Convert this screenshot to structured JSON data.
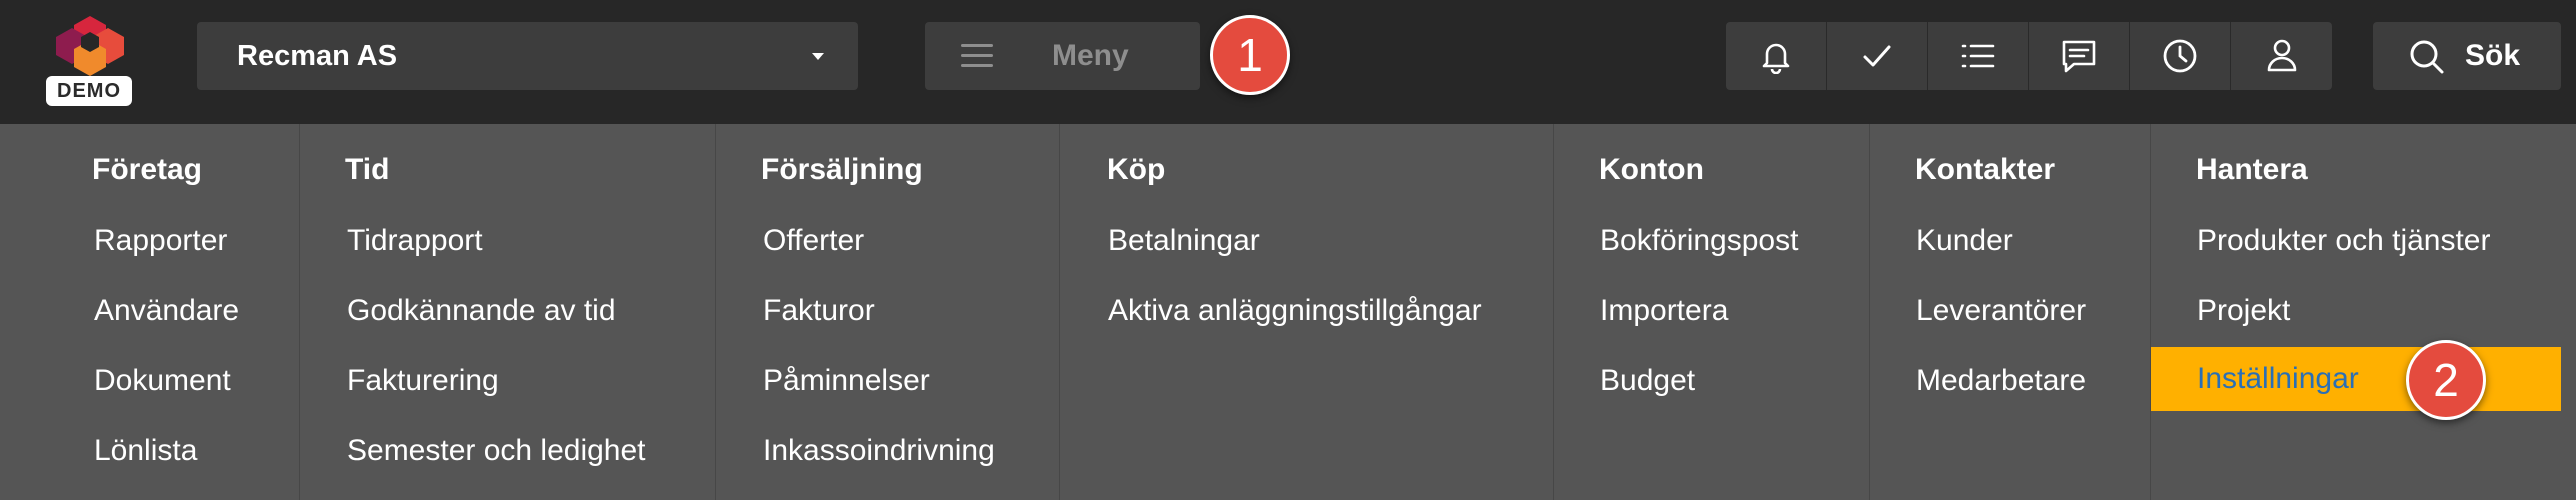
{
  "logo": {
    "badge": "DEMO",
    "colors": [
      "#c0392b",
      "#e74c3c",
      "#8e1c4e",
      "#e67e22"
    ]
  },
  "header": {
    "company": "Recman AS",
    "menu_label": "Meny",
    "search_label": "Sök",
    "icons": [
      "bell-icon",
      "check-icon",
      "list-icon",
      "chat-icon",
      "clock-icon",
      "user-icon"
    ]
  },
  "badges": {
    "first": "1",
    "second": "2"
  },
  "menu": {
    "columns": [
      {
        "title": "Företag",
        "items": [
          "Rapporter",
          "Användare",
          "Dokument",
          "Lönlista"
        ]
      },
      {
        "title": "Tid",
        "items": [
          "Tidrapport",
          "Godkännande av tid",
          "Fakturering",
          "Semester och ledighet"
        ]
      },
      {
        "title": "Försäljning",
        "items": [
          "Offerter",
          "Fakturor",
          "Påminnelser",
          "Inkassoindrivning"
        ]
      },
      {
        "title": "Köp",
        "items": [
          "Betalningar",
          "Aktiva anläggningstillgångar"
        ]
      },
      {
        "title": "Konton",
        "items": [
          "Bokföringspost",
          "Importera",
          "Budget"
        ]
      },
      {
        "title": "Kontakter",
        "items": [
          "Kunder",
          "Leverantörer",
          "Medarbetare"
        ]
      },
      {
        "title": "Hantera",
        "items": [
          "Produkter och tjänster",
          "Projekt",
          "Inställningar"
        ]
      }
    ],
    "highlighted_item": "Inställningar",
    "highlight_color": "#ffb000"
  }
}
